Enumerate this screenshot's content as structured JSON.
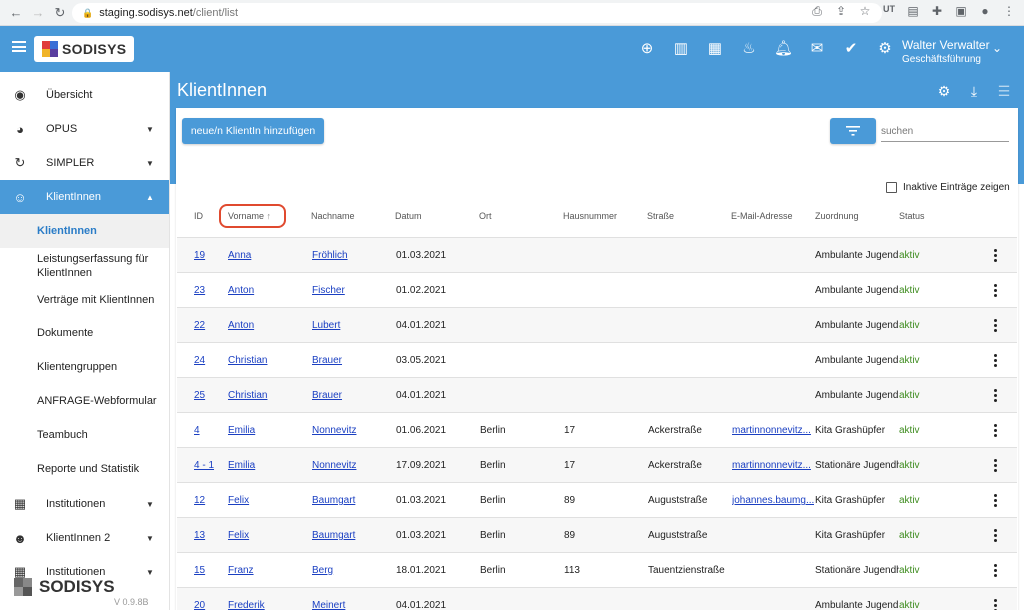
{
  "browser": {
    "url_host": "staging.sodisys.net",
    "url_path": "/client/list"
  },
  "header": {
    "brand": "SODISYS",
    "user_name": "Walter Verwalter",
    "user_role": "Geschäftsführung",
    "icons": [
      "add-circle-icon",
      "board-icon",
      "calendar-icon",
      "cake-icon",
      "bell-icon",
      "mail-icon",
      "check-circle-icon",
      "settings-icon"
    ]
  },
  "sidebar": {
    "items": [
      {
        "label": "Übersicht"
      },
      {
        "label": "OPUS"
      },
      {
        "label": "SIMPLER"
      },
      {
        "label": "KlientInnen"
      },
      {
        "label": "Institutionen"
      },
      {
        "label": "KlientInnen 2"
      },
      {
        "label": "Institutionen"
      }
    ],
    "subitems": [
      {
        "label": "KlientInnen"
      },
      {
        "label": "Leistungserfassung für KlientInnen"
      },
      {
        "label": "Verträge mit KlientInnen"
      },
      {
        "label": "Dokumente"
      },
      {
        "label": "Klientengruppen"
      },
      {
        "label": "ANFRAGE-Webformular"
      },
      {
        "label": "Teambuch"
      },
      {
        "label": "Reporte und Statistik"
      }
    ],
    "brand": "SODISYS",
    "version": "V 0.9.8B"
  },
  "main": {
    "title": "KlientInnen",
    "add_button": "neue/n KlientIn hinzufügen",
    "search_placeholder": "suchen",
    "inactive_label": "Inaktive Einträge zeigen",
    "sort_arrow": "↑",
    "columns": [
      "ID",
      "Vorname",
      "Nachname",
      "Datum",
      "Ort",
      "Hausnummer",
      "Straße",
      "E-Mail-Adresse",
      "Zuordnung",
      "Status"
    ],
    "rows": [
      {
        "id": "19",
        "first": "Anna",
        "last": "Fröhlich",
        "date": "01.03.2021",
        "city": "",
        "nr": "",
        "street": "",
        "email": "",
        "assign": "Ambulante Jugendh",
        "status": "aktiv"
      },
      {
        "id": "23",
        "first": "Anton",
        "last": "Fischer",
        "date": "01.02.2021",
        "city": "",
        "nr": "",
        "street": "",
        "email": "",
        "assign": "Ambulante Jugendh",
        "status": "aktiv"
      },
      {
        "id": "22",
        "first": "Anton",
        "last": "Lubert",
        "date": "04.01.2021",
        "city": "",
        "nr": "",
        "street": "",
        "email": "",
        "assign": "Ambulante Jugendh",
        "status": "aktiv"
      },
      {
        "id": "24",
        "first": "Christian",
        "last": "Brauer",
        "date": "03.05.2021",
        "city": "",
        "nr": "",
        "street": "",
        "email": "",
        "assign": "Ambulante Jugendh",
        "status": "aktiv"
      },
      {
        "id": "25",
        "first": "Christian",
        "last": "Brauer",
        "date": "04.01.2021",
        "city": "",
        "nr": "",
        "street": "",
        "email": "",
        "assign": "Ambulante Jugendh",
        "status": "aktiv"
      },
      {
        "id": "4",
        "first": "Emilia",
        "last": "Nonnevitz",
        "date": "01.06.2021",
        "city": "Berlin",
        "nr": "17",
        "street": "Ackerstraße",
        "email": "martinnonnevitz...",
        "assign": "Kita Grashüpfer",
        "status": "aktiv"
      },
      {
        "id": "4 - 1",
        "first": "Emilia",
        "last": "Nonnevitz",
        "date": "17.09.2021",
        "city": "Berlin",
        "nr": "17",
        "street": "Ackerstraße",
        "email": "martinnonnevitz...",
        "assign": "Stationäre Jugendh",
        "status": "aktiv"
      },
      {
        "id": "12",
        "first": "Felix",
        "last": "Baumgart",
        "date": "01.03.2021",
        "city": "Berlin",
        "nr": "89",
        "street": "Auguststraße",
        "email": "johannes.baumg...",
        "assign": "Kita Grashüpfer",
        "status": "aktiv"
      },
      {
        "id": "13",
        "first": "Felix",
        "last": "Baumgart",
        "date": "01.03.2021",
        "city": "Berlin",
        "nr": "89",
        "street": "Auguststraße",
        "email": "",
        "assign": "Kita Grashüpfer",
        "status": "aktiv"
      },
      {
        "id": "15",
        "first": "Franz",
        "last": "Berg",
        "date": "18.01.2021",
        "city": "Berlin",
        "nr": "113",
        "street": "Tauentzienstraße",
        "email": "",
        "assign": "Stationäre Jugendh",
        "status": "aktiv"
      },
      {
        "id": "20",
        "first": "Frederik",
        "last": "Meinert",
        "date": "04.01.2021",
        "city": "",
        "nr": "",
        "street": "",
        "email": "",
        "assign": "Ambulante Jugendh",
        "status": "aktiv"
      }
    ]
  }
}
